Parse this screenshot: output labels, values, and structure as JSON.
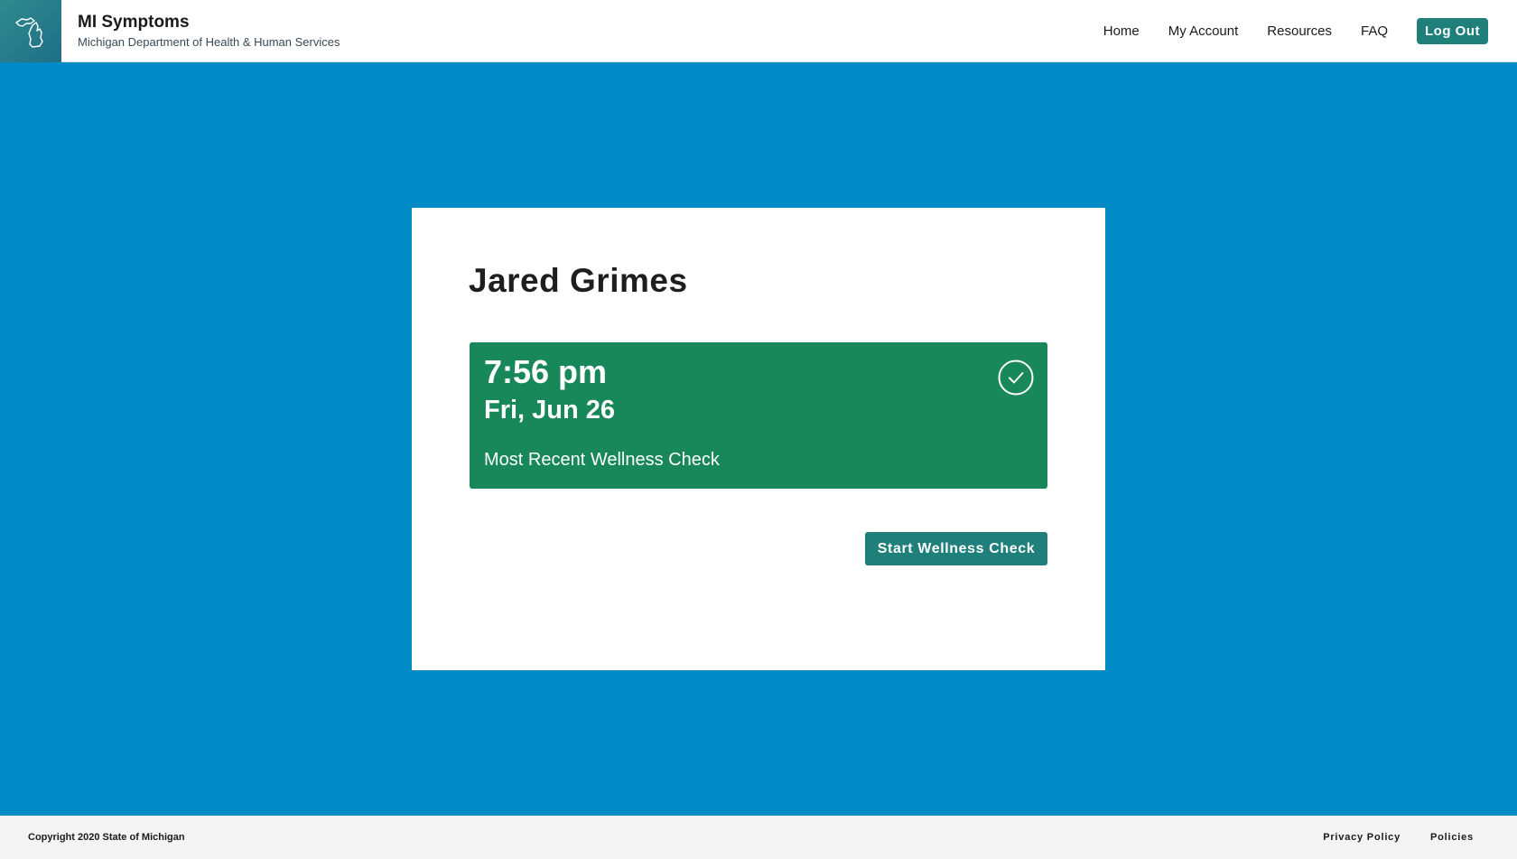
{
  "header": {
    "title": "MI Symptoms",
    "subtitle": "Michigan Department of Health & Human Services",
    "logo_icon": "michigan-map-icon",
    "nav": {
      "home": "Home",
      "my_account": "My Account",
      "resources": "Resources",
      "faq": "FAQ"
    },
    "logout_label": "Log Out"
  },
  "main": {
    "user_name": "Jared Grimes",
    "status": {
      "time": "7:56 pm",
      "date": "Fri, Jun 26",
      "label": "Most Recent Wellness Check",
      "icon": "check-circle-icon"
    },
    "start_button_label": "Start Wellness Check"
  },
  "footer": {
    "copyright": "Copyright 2020 State of Michigan",
    "links": {
      "privacy_policy": "Privacy Policy",
      "policies": "Policies"
    }
  },
  "colors": {
    "background": "#008bc6",
    "accent": "#1f7f7a",
    "status_green": "#18875a",
    "footer_bg": "#f4f4f4"
  }
}
